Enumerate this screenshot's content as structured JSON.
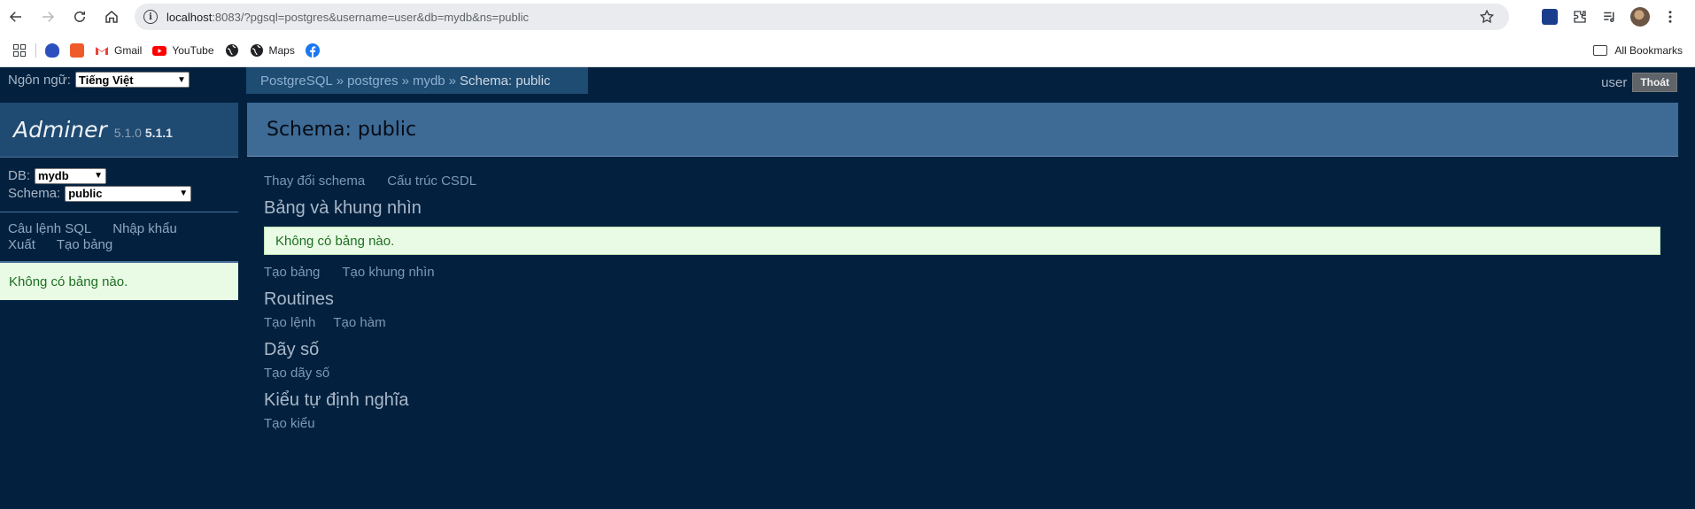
{
  "browser": {
    "url_host": "localhost",
    "url_rest": ":8083/?pgsql=postgres&username=user&db=mydb&ns=public",
    "bookmarks": [
      {
        "label": "",
        "icon": "blue-extension-icon"
      },
      {
        "label": "",
        "icon": "orange-shopping-icon"
      },
      {
        "label": "Gmail",
        "icon": "gmail-icon"
      },
      {
        "label": "YouTube",
        "icon": "youtube-icon"
      },
      {
        "label": "",
        "icon": "globe-icon"
      },
      {
        "label": "Maps",
        "icon": "globe-icon"
      },
      {
        "label": "",
        "icon": "facebook-icon"
      }
    ],
    "all_bookmarks": "All Bookmarks"
  },
  "adminer": {
    "language_label": "Ngôn ngữ:",
    "language_value": "Tiếng Việt",
    "breadcrumb": {
      "items": [
        "PostgreSQL",
        "postgres",
        "mydb"
      ],
      "current": "Schema: public",
      "separator": "»"
    },
    "user": "user",
    "logout_label": "Thoát",
    "logo": {
      "name": "Adminer",
      "version_old": "5.1.0",
      "version_new": "5.1.1"
    },
    "db_label": "DB:",
    "db_value": "mydb",
    "schema_label": "Schema:",
    "schema_value": "public",
    "side_links": [
      "Câu lệnh SQL",
      "Nhập khẩu",
      "Xuất",
      "Tạo bảng"
    ],
    "side_message": "Không có bảng nào.",
    "page_title": "Schema: public",
    "top_links": [
      "Thay đổi schema",
      "Cấu trúc CSDL"
    ],
    "sections": {
      "tables": {
        "heading": "Bảng và khung nhìn",
        "message": "Không có bảng nào.",
        "links": [
          "Tạo bảng",
          "Tạo khung nhìn"
        ]
      },
      "routines": {
        "heading": "Routines",
        "links": [
          "Tạo lệnh",
          "Tạo hàm"
        ]
      },
      "sequences": {
        "heading": "Dãy số",
        "links": [
          "Tạo dãy số"
        ]
      },
      "types": {
        "heading": "Kiểu tự định nghĩa",
        "links": [
          "Tạo kiểu"
        ]
      }
    },
    "colors": {
      "background": "#03213f",
      "header": "#3d6b96",
      "link": "#7d98b4",
      "message_bg": "#e9fbe5"
    }
  }
}
